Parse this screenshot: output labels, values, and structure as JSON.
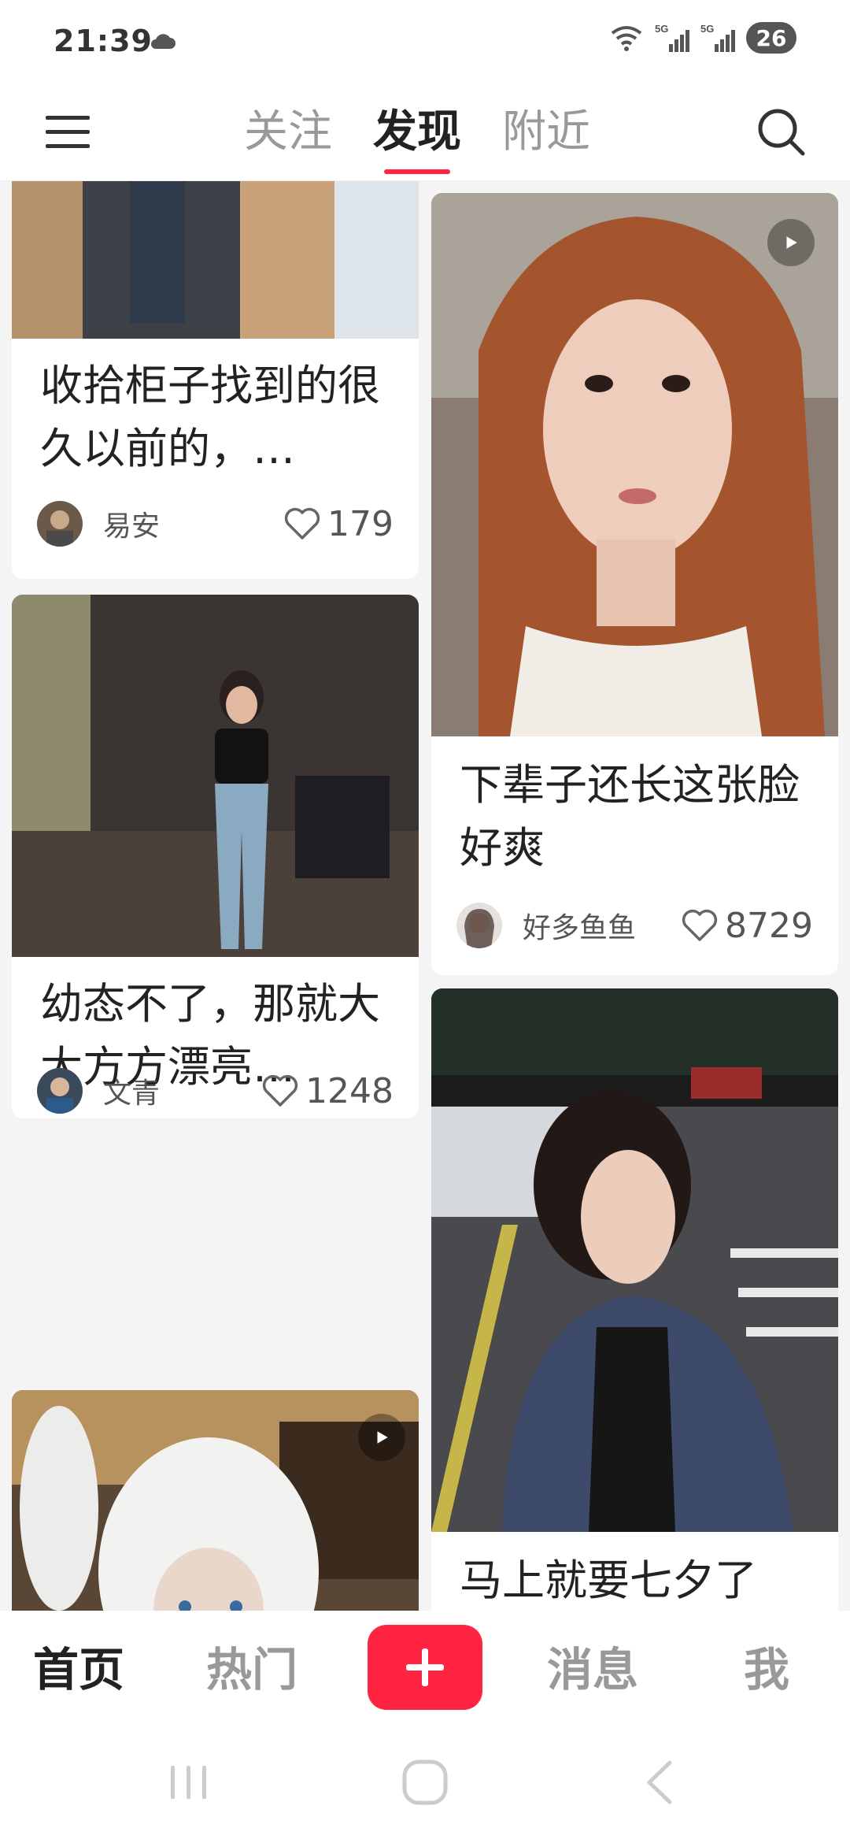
{
  "status_bar": {
    "time": "21:39",
    "network_1": "5G",
    "network_2": "5G",
    "battery": "26"
  },
  "top_nav": {
    "tabs": [
      {
        "label": "关注",
        "active": false
      },
      {
        "label": "发现",
        "active": true
      },
      {
        "label": "附近",
        "active": false
      }
    ]
  },
  "feed": {
    "left": [
      {
        "title": "收拾柜子找到的很久以前的，…",
        "author": "易安",
        "likes": "179"
      },
      {
        "title": "幼态不了，那就大大方方漂亮…",
        "author": "文青",
        "likes": "1248"
      },
      {
        "title": "",
        "author": "",
        "likes": ""
      }
    ],
    "right": [
      {
        "title": "下辈子还长这张脸 好爽",
        "author": "好多鱼鱼",
        "likes": "8729"
      },
      {
        "title": "马上就要七夕了",
        "author": "",
        "likes": ""
      }
    ]
  },
  "bottom_nav": {
    "home": "首页",
    "hot": "热门",
    "messages": "消息",
    "me": "我"
  },
  "colors": {
    "accent": "#ff2442",
    "text": "#222222",
    "muted": "#999999"
  }
}
